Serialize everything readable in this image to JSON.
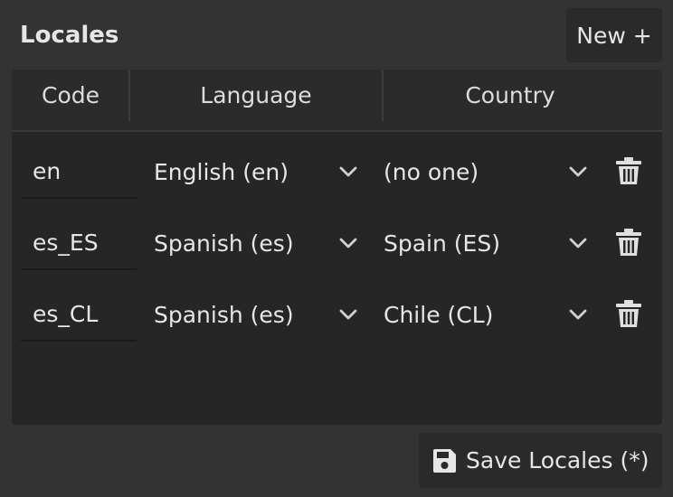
{
  "title": "Locales",
  "new_button": "New +",
  "headers": [
    "Code",
    "Language",
    "Country"
  ],
  "rows": [
    {
      "code": "en",
      "language": "English (en)",
      "country": "(no one)"
    },
    {
      "code": "es_ES",
      "language": "Spanish (es)",
      "country": "Spain (ES)"
    },
    {
      "code": "es_CL",
      "language": "Spanish (es)",
      "country": "Chile (CL)"
    }
  ],
  "save_button": "Save Locales (*)",
  "icons": {
    "dropdown": "chevron-down-icon",
    "delete": "trash-icon",
    "save": "floppy-disk-icon"
  },
  "colors": {
    "background": "#333333",
    "panel": "#262626",
    "header": "#2b2b2b",
    "text": "#e6e6e6"
  }
}
